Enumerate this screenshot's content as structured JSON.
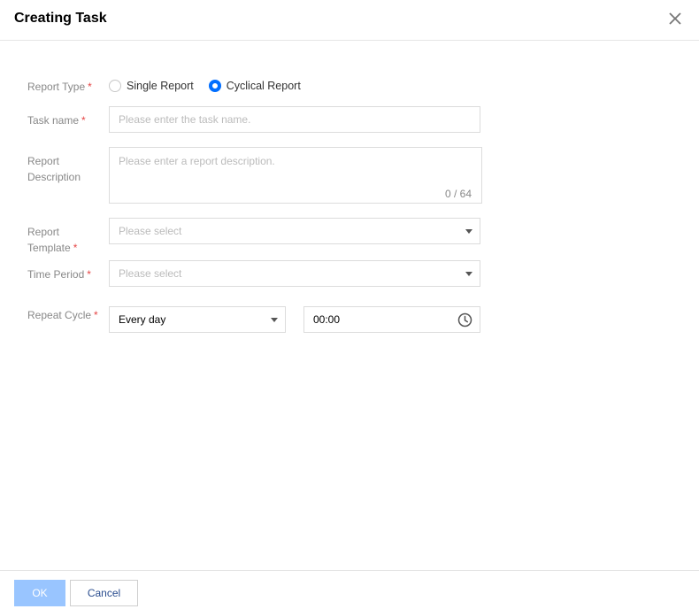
{
  "dialog": {
    "title": "Creating Task",
    "close_icon": "close-icon"
  },
  "form": {
    "report_type": {
      "label": "Report Type",
      "required": "*",
      "options": [
        {
          "label": "Single Report",
          "checked": false
        },
        {
          "label": "Cyclical Report",
          "checked": true
        }
      ]
    },
    "task_name": {
      "label": "Task name",
      "required": "*",
      "value": "",
      "placeholder": "Please enter the task name."
    },
    "report_description": {
      "label_line1": "Report",
      "label_line2": "Description",
      "value": "",
      "placeholder": "Please enter a report description.",
      "counter": "0 / 64"
    },
    "report_template": {
      "label_line1": "Report",
      "label_line2": "Template",
      "required": "*",
      "placeholder": "Please select"
    },
    "time_period": {
      "label": "Time Period",
      "required": "*",
      "placeholder": "Please select"
    },
    "repeat_cycle": {
      "label": "Repeat Cycle",
      "required": "*",
      "selected": "Every day",
      "time": "00:00",
      "time_icon": "clock-icon"
    }
  },
  "footer": {
    "ok_label": "OK",
    "cancel_label": "Cancel"
  },
  "colors": {
    "accent": "#006eff",
    "required": "#e54545",
    "ok_disabled": "#99c5ff"
  }
}
